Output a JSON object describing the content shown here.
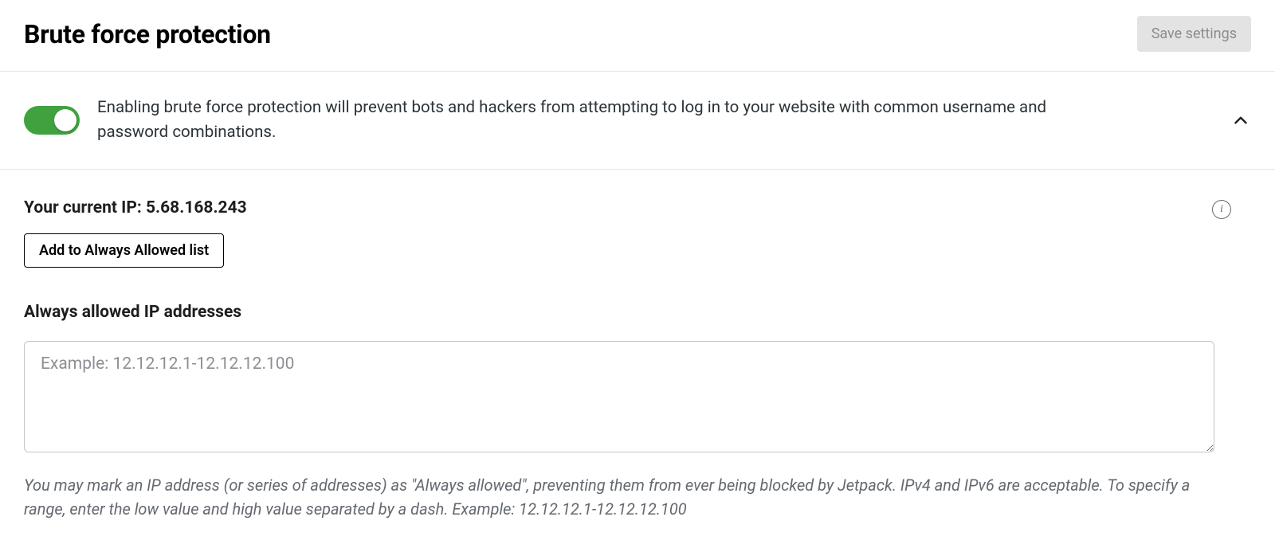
{
  "header": {
    "title": "Brute force protection",
    "save_label": "Save settings"
  },
  "toggle": {
    "enabled": true,
    "description": "Enabling brute force protection will prevent bots and hackers from attempting to log in to your website with common username and password combinations."
  },
  "ip": {
    "label_full": "Your current IP: 5.68.168.243",
    "value": "5.68.168.243",
    "add_button_label": "Add to Always Allowed list"
  },
  "allowlist": {
    "label": "Always allowed IP addresses",
    "value": "",
    "placeholder": "Example: 12.12.12.1-12.12.12.100",
    "help": "You may mark an IP address (or series of addresses) as \"Always allowed\", preventing them from ever being blocked by Jetpack. IPv4 and IPv6 are acceptable. To specify a range, enter the low value and high value separated by a dash. Example: 12.12.12.1-12.12.12.100"
  },
  "colors": {
    "toggle_on": "#3fa23f",
    "border": "#e6e6e6",
    "muted_text": "#646970"
  }
}
